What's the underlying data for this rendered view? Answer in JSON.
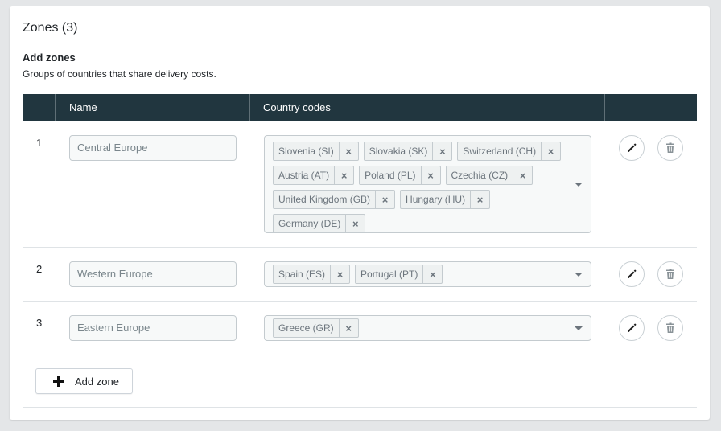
{
  "card": {
    "title": "Zones (3)",
    "section_title": "Add zones",
    "section_desc": "Groups of countries that share delivery costs."
  },
  "table": {
    "columns": [
      "Name",
      "Country codes"
    ],
    "rows": [
      {
        "number": "1",
        "name": "Central Europe",
        "countries": [
          "Slovenia (SI)",
          "Slovakia (SK)",
          "Switzerland (CH)",
          "Austria (AT)",
          "Poland (PL)",
          "Czechia (CZ)",
          "United Kingdom (GB)",
          "Hungary (HU)",
          "Germany (DE)"
        ]
      },
      {
        "number": "2",
        "name": "Western Europe",
        "countries": [
          "Spain (ES)",
          "Portugal (PT)"
        ]
      },
      {
        "number": "3",
        "name": "Eastern Europe",
        "countries": [
          "Greece (GR)"
        ]
      }
    ]
  },
  "actions": {
    "add_zone_label": "Add zone"
  },
  "icons": {
    "chip_remove": "×",
    "edit": "pencil-icon",
    "delete": "trash-icon",
    "add": "plus-icon"
  },
  "colors": {
    "header_bg": "#21363f",
    "header_text": "#ffffff",
    "chip_bg": "#eef1f1"
  }
}
